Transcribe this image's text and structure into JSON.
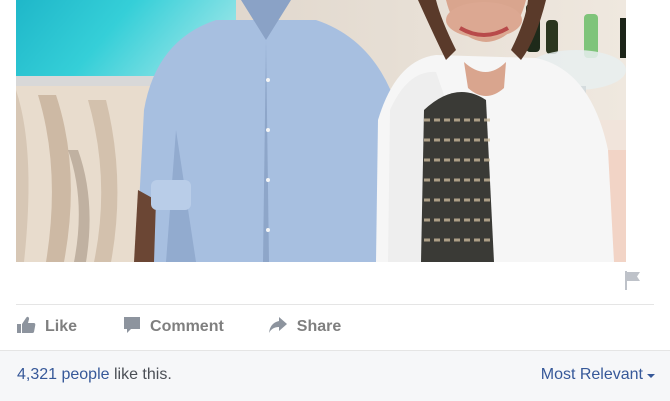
{
  "post": {
    "photo_alt": "",
    "actions": {
      "like": "Like",
      "comment": "Comment",
      "share": "Share"
    },
    "likes": {
      "count_text": "4,321 people",
      "suffix": " like this."
    },
    "sort": {
      "label": "Most Relevant"
    }
  },
  "icons": {
    "like": "thumbs-up-icon",
    "comment": "speech-bubble-icon",
    "share": "share-arrow-icon",
    "report": "flag-icon",
    "sort": "caret-down-icon"
  },
  "colors": {
    "link": "#365899",
    "action_text": "#7f7f7f",
    "footer_bg": "#f6f7f9",
    "divider": "#e5e5e5"
  }
}
